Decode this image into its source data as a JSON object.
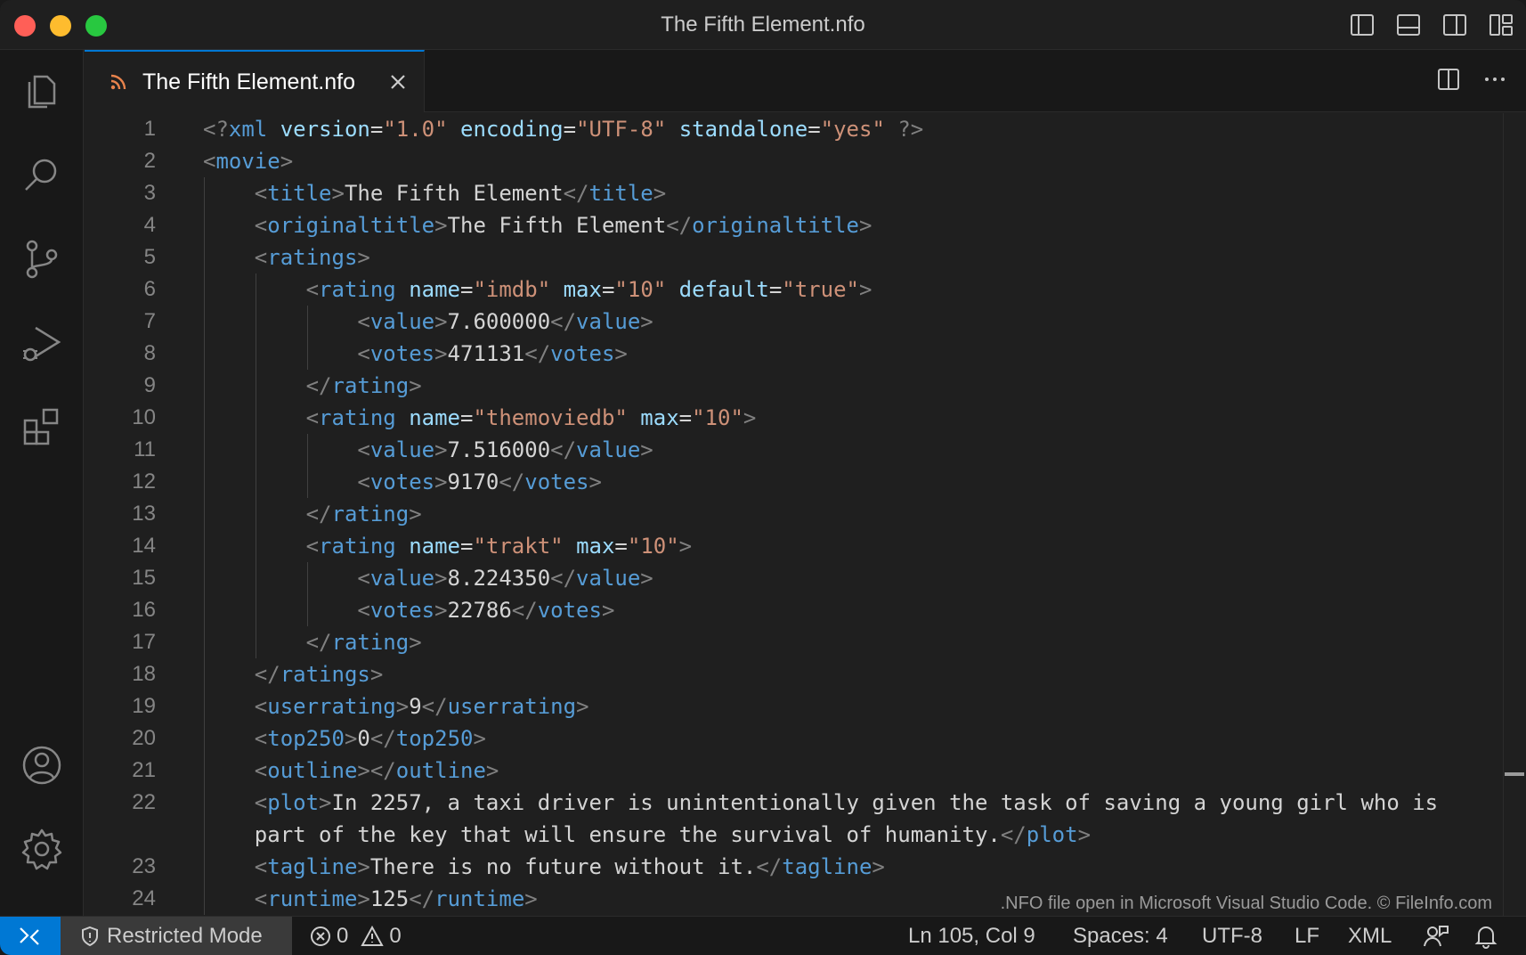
{
  "window": {
    "title": "The Fifth Element.nfo"
  },
  "titlebar_icons": [
    "toggle-primary-sidebar-icon",
    "toggle-panel-icon",
    "toggle-secondary-sidebar-icon",
    "customize-layout-icon"
  ],
  "activity_bar": [
    "explorer-icon",
    "search-icon",
    "source-control-icon",
    "run-debug-icon",
    "extensions-icon",
    "accounts-icon",
    "manage-gear-icon"
  ],
  "tab": {
    "label": "The Fifth Element.nfo",
    "icon": "rss-icon"
  },
  "editor_actions": [
    "split-editor-icon",
    "more-actions-icon"
  ],
  "editor": {
    "lines": [
      {
        "n": "1",
        "indent": 0,
        "tokens": [
          [
            "p",
            "<?"
          ],
          [
            "t",
            "xml"
          ],
          [
            "tx",
            " "
          ],
          [
            "a",
            "version"
          ],
          [
            "tx",
            "="
          ],
          [
            "s",
            "\"1.0\""
          ],
          [
            "tx",
            " "
          ],
          [
            "a",
            "encoding"
          ],
          [
            "tx",
            "="
          ],
          [
            "s",
            "\"UTF-8\""
          ],
          [
            "tx",
            " "
          ],
          [
            "a",
            "standalone"
          ],
          [
            "tx",
            "="
          ],
          [
            "s",
            "\"yes\""
          ],
          [
            "tx",
            " "
          ],
          [
            "p",
            "?>"
          ]
        ]
      },
      {
        "n": "2",
        "indent": 0,
        "tokens": [
          [
            "p",
            "<"
          ],
          [
            "t",
            "movie"
          ],
          [
            "p",
            ">"
          ]
        ]
      },
      {
        "n": "3",
        "indent": 1,
        "tokens": [
          [
            "p",
            "<"
          ],
          [
            "t",
            "title"
          ],
          [
            "p",
            ">"
          ],
          [
            "tx",
            "The Fifth Element"
          ],
          [
            "p",
            "</"
          ],
          [
            "t",
            "title"
          ],
          [
            "p",
            ">"
          ]
        ]
      },
      {
        "n": "4",
        "indent": 1,
        "tokens": [
          [
            "p",
            "<"
          ],
          [
            "t",
            "originaltitle"
          ],
          [
            "p",
            ">"
          ],
          [
            "tx",
            "The Fifth Element"
          ],
          [
            "p",
            "</"
          ],
          [
            "t",
            "originaltitle"
          ],
          [
            "p",
            ">"
          ]
        ]
      },
      {
        "n": "5",
        "indent": 1,
        "tokens": [
          [
            "p",
            "<"
          ],
          [
            "t",
            "ratings"
          ],
          [
            "p",
            ">"
          ]
        ]
      },
      {
        "n": "6",
        "indent": 2,
        "tokens": [
          [
            "p",
            "<"
          ],
          [
            "t",
            "rating"
          ],
          [
            "tx",
            " "
          ],
          [
            "a",
            "name"
          ],
          [
            "tx",
            "="
          ],
          [
            "s",
            "\"imdb\""
          ],
          [
            "tx",
            " "
          ],
          [
            "a",
            "max"
          ],
          [
            "tx",
            "="
          ],
          [
            "s",
            "\"10\""
          ],
          [
            "tx",
            " "
          ],
          [
            "a",
            "default"
          ],
          [
            "tx",
            "="
          ],
          [
            "s",
            "\"true\""
          ],
          [
            "p",
            ">"
          ]
        ]
      },
      {
        "n": "7",
        "indent": 3,
        "tokens": [
          [
            "p",
            "<"
          ],
          [
            "t",
            "value"
          ],
          [
            "p",
            ">"
          ],
          [
            "tx",
            "7.600000"
          ],
          [
            "p",
            "</"
          ],
          [
            "t",
            "value"
          ],
          [
            "p",
            ">"
          ]
        ]
      },
      {
        "n": "8",
        "indent": 3,
        "tokens": [
          [
            "p",
            "<"
          ],
          [
            "t",
            "votes"
          ],
          [
            "p",
            ">"
          ],
          [
            "tx",
            "471131"
          ],
          [
            "p",
            "</"
          ],
          [
            "t",
            "votes"
          ],
          [
            "p",
            ">"
          ]
        ]
      },
      {
        "n": "9",
        "indent": 2,
        "tokens": [
          [
            "p",
            "</"
          ],
          [
            "t",
            "rating"
          ],
          [
            "p",
            ">"
          ]
        ]
      },
      {
        "n": "10",
        "indent": 2,
        "tokens": [
          [
            "p",
            "<"
          ],
          [
            "t",
            "rating"
          ],
          [
            "tx",
            " "
          ],
          [
            "a",
            "name"
          ],
          [
            "tx",
            "="
          ],
          [
            "s",
            "\"themoviedb\""
          ],
          [
            "tx",
            " "
          ],
          [
            "a",
            "max"
          ],
          [
            "tx",
            "="
          ],
          [
            "s",
            "\"10\""
          ],
          [
            "p",
            ">"
          ]
        ]
      },
      {
        "n": "11",
        "indent": 3,
        "tokens": [
          [
            "p",
            "<"
          ],
          [
            "t",
            "value"
          ],
          [
            "p",
            ">"
          ],
          [
            "tx",
            "7.516000"
          ],
          [
            "p",
            "</"
          ],
          [
            "t",
            "value"
          ],
          [
            "p",
            ">"
          ]
        ]
      },
      {
        "n": "12",
        "indent": 3,
        "tokens": [
          [
            "p",
            "<"
          ],
          [
            "t",
            "votes"
          ],
          [
            "p",
            ">"
          ],
          [
            "tx",
            "9170"
          ],
          [
            "p",
            "</"
          ],
          [
            "t",
            "votes"
          ],
          [
            "p",
            ">"
          ]
        ]
      },
      {
        "n": "13",
        "indent": 2,
        "tokens": [
          [
            "p",
            "</"
          ],
          [
            "t",
            "rating"
          ],
          [
            "p",
            ">"
          ]
        ]
      },
      {
        "n": "14",
        "indent": 2,
        "tokens": [
          [
            "p",
            "<"
          ],
          [
            "t",
            "rating"
          ],
          [
            "tx",
            " "
          ],
          [
            "a",
            "name"
          ],
          [
            "tx",
            "="
          ],
          [
            "s",
            "\"trakt\""
          ],
          [
            "tx",
            " "
          ],
          [
            "a",
            "max"
          ],
          [
            "tx",
            "="
          ],
          [
            "s",
            "\"10\""
          ],
          [
            "p",
            ">"
          ]
        ]
      },
      {
        "n": "15",
        "indent": 3,
        "tokens": [
          [
            "p",
            "<"
          ],
          [
            "t",
            "value"
          ],
          [
            "p",
            ">"
          ],
          [
            "tx",
            "8.224350"
          ],
          [
            "p",
            "</"
          ],
          [
            "t",
            "value"
          ],
          [
            "p",
            ">"
          ]
        ]
      },
      {
        "n": "16",
        "indent": 3,
        "tokens": [
          [
            "p",
            "<"
          ],
          [
            "t",
            "votes"
          ],
          [
            "p",
            ">"
          ],
          [
            "tx",
            "22786"
          ],
          [
            "p",
            "</"
          ],
          [
            "t",
            "votes"
          ],
          [
            "p",
            ">"
          ]
        ]
      },
      {
        "n": "17",
        "indent": 2,
        "tokens": [
          [
            "p",
            "</"
          ],
          [
            "t",
            "rating"
          ],
          [
            "p",
            ">"
          ]
        ]
      },
      {
        "n": "18",
        "indent": 1,
        "tokens": [
          [
            "p",
            "</"
          ],
          [
            "t",
            "ratings"
          ],
          [
            "p",
            ">"
          ]
        ]
      },
      {
        "n": "19",
        "indent": 1,
        "tokens": [
          [
            "p",
            "<"
          ],
          [
            "t",
            "userrating"
          ],
          [
            "p",
            ">"
          ],
          [
            "tx",
            "9"
          ],
          [
            "p",
            "</"
          ],
          [
            "t",
            "userrating"
          ],
          [
            "p",
            ">"
          ]
        ]
      },
      {
        "n": "20",
        "indent": 1,
        "tokens": [
          [
            "p",
            "<"
          ],
          [
            "t",
            "top250"
          ],
          [
            "p",
            ">"
          ],
          [
            "tx",
            "0"
          ],
          [
            "p",
            "</"
          ],
          [
            "t",
            "top250"
          ],
          [
            "p",
            ">"
          ]
        ]
      },
      {
        "n": "21",
        "indent": 1,
        "tokens": [
          [
            "p",
            "<"
          ],
          [
            "t",
            "outline"
          ],
          [
            "p",
            "></"
          ],
          [
            "t",
            "outline"
          ],
          [
            "p",
            ">"
          ]
        ]
      },
      {
        "n": "22",
        "indent": 1,
        "tokens": [
          [
            "p",
            "<"
          ],
          [
            "t",
            "plot"
          ],
          [
            "p",
            ">"
          ],
          [
            "tx",
            "In 2257, a taxi driver is unintentionally given the task of saving a young girl who is"
          ]
        ]
      },
      {
        "n": "",
        "indent": 1,
        "tokens": [
          [
            "tx",
            "part of the key that will ensure the survival of humanity."
          ],
          [
            "p",
            "</"
          ],
          [
            "t",
            "plot"
          ],
          [
            "p",
            ">"
          ]
        ]
      },
      {
        "n": "23",
        "indent": 1,
        "tokens": [
          [
            "p",
            "<"
          ],
          [
            "t",
            "tagline"
          ],
          [
            "p",
            ">"
          ],
          [
            "tx",
            "There is no future without it."
          ],
          [
            "p",
            "</"
          ],
          [
            "t",
            "tagline"
          ],
          [
            "p",
            ">"
          ]
        ]
      },
      {
        "n": "24",
        "indent": 1,
        "tokens": [
          [
            "p",
            "<"
          ],
          [
            "t",
            "runtime"
          ],
          [
            "p",
            ">"
          ],
          [
            "tx",
            "125"
          ],
          [
            "p",
            "</"
          ],
          [
            "t",
            "runtime"
          ],
          [
            "p",
            ">"
          ]
        ]
      }
    ]
  },
  "watermark": ".NFO file open in Microsoft Visual Studio Code. © FileInfo.com",
  "status": {
    "restricted": "Restricted Mode",
    "errors": "0",
    "warnings": "0",
    "position": "Ln 105, Col 9",
    "spaces": "Spaces: 4",
    "encoding": "UTF-8",
    "eol": "LF",
    "language": "XML"
  },
  "colors": {
    "accent": "#0078d4",
    "tag": "#569cd6",
    "attr": "#9cdcfe",
    "string": "#ce9178",
    "punct": "#808080"
  }
}
